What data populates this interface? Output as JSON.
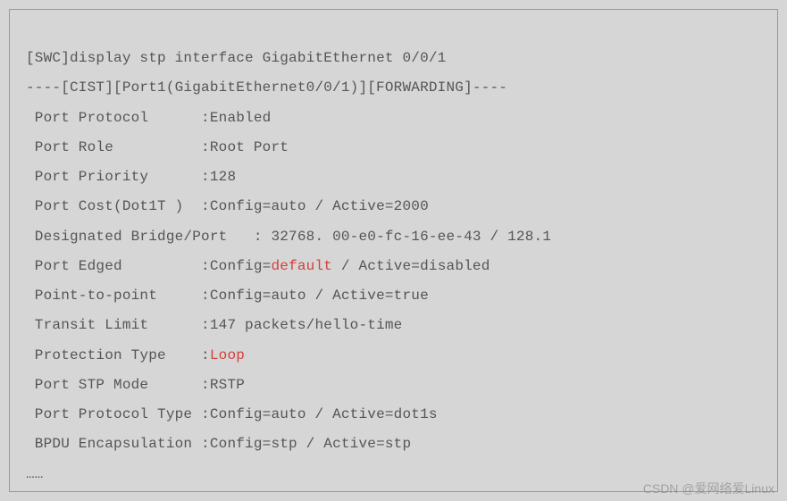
{
  "terminal": {
    "prompt": "[SWC]",
    "command": "display stp interface GigabitEthernet 0/0/1",
    "header": "----[CIST][Port1(GigabitEthernet0/0/1)][FORWARDING]----",
    "rows": {
      "port_protocol": {
        "label": " Port Protocol      ",
        "sep": ":",
        "value": "Enabled"
      },
      "port_role": {
        "label": " Port Role          ",
        "sep": ":",
        "value": "Root Port"
      },
      "port_priority": {
        "label": " Port Priority      ",
        "sep": ":",
        "value": "128"
      },
      "port_cost": {
        "label": " Port Cost(Dot1T )  ",
        "sep": ":",
        "value": "Config=auto / Active=2000"
      },
      "designated": {
        "label": " Designated Bridge/Port   ",
        "sep": ": ",
        "value": "32768. 00-e0-fc-16-ee-43 / 128.1"
      },
      "port_edged": {
        "label": " Port Edged         ",
        "sep": ":",
        "pre": "Config=",
        "red": "default",
        "post": " / Active=disabled"
      },
      "point_to_point": {
        "label": " Point-to-point     ",
        "sep": ":",
        "value": "Config=auto / Active=true"
      },
      "transit_limit": {
        "label": " Transit Limit      ",
        "sep": ":",
        "value": "147 packets/hello-time"
      },
      "protection_type": {
        "label": " Protection Type    ",
        "sep": ":",
        "red": "Loop"
      },
      "port_stp_mode": {
        "label": " Port STP Mode      ",
        "sep": ":",
        "value": "RSTP"
      },
      "port_protocol_type": {
        "label": " Port Protocol Type ",
        "sep": ":",
        "value": "Config=auto / Active=dot1s"
      },
      "bpdu_encapsulation": {
        "label": " BPDU Encapsulation ",
        "sep": ":",
        "value": "Config=stp / Active=stp"
      }
    },
    "ellipsis": "……"
  },
  "watermark": "CSDN @爱网络爱Linux"
}
